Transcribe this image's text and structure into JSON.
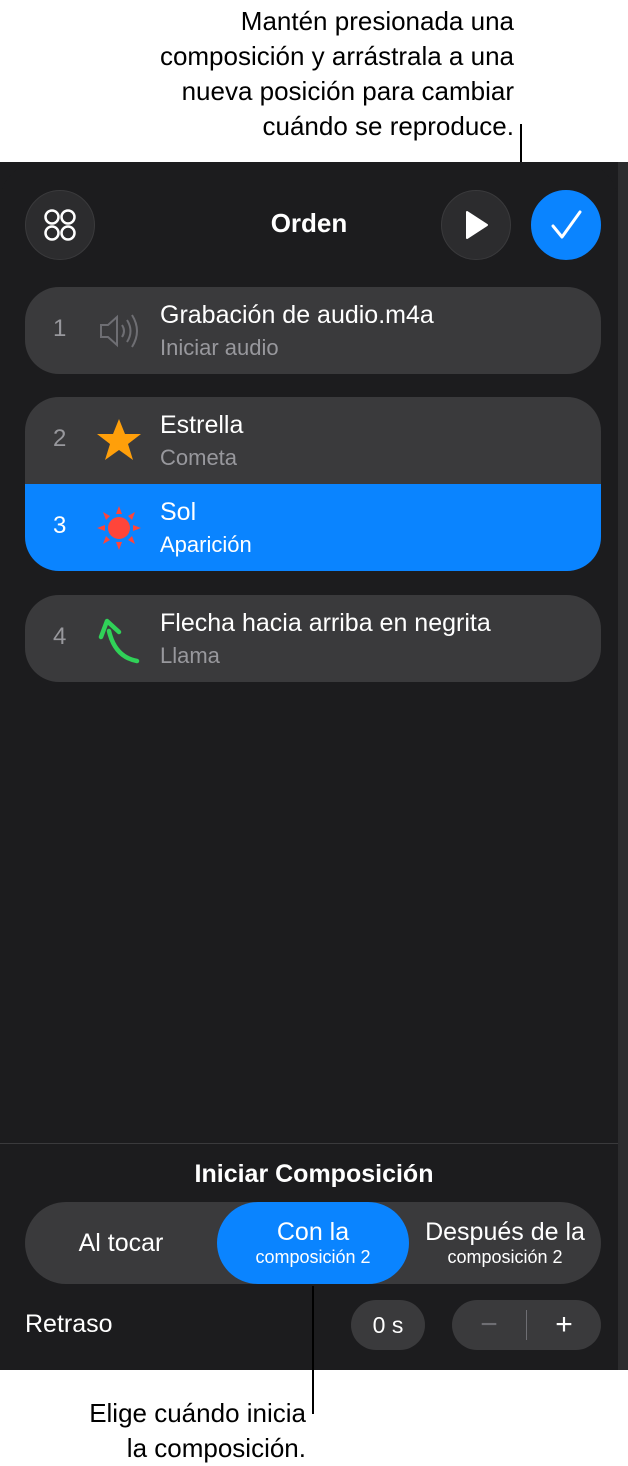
{
  "callouts": {
    "top": [
      "Mantén presionada una",
      "composición y arrástrala a una",
      "nueva posición para cambiar",
      "cuándo se reproduce."
    ],
    "bottom": [
      "Elige cuándo inicia",
      "la composición."
    ]
  },
  "header": {
    "title": "Orden",
    "grid_icon": "animations-grid-icon",
    "play_icon": "play-icon",
    "done_icon": "checkmark-icon"
  },
  "builds": [
    {
      "number": "1",
      "name": "Grabación de audio.m4a",
      "effect": "Iniciar audio",
      "icon": "speaker-icon"
    },
    {
      "number": "2",
      "name": "Estrella",
      "effect": "Cometa",
      "icon": "star-icon"
    },
    {
      "number": "3",
      "name": "Sol",
      "effect": "Aparición",
      "icon": "sun-icon"
    },
    {
      "number": "4",
      "name": "Flecha hacia arriba en negrita",
      "effect": "Llama",
      "icon": "arrow-icon"
    }
  ],
  "start": {
    "title": "Iniciar Composición",
    "options": [
      {
        "line1": "Al tocar",
        "line2": ""
      },
      {
        "line1": "Con la",
        "line2": "composición 2"
      },
      {
        "line1": "Después de la",
        "line2": "composición 2"
      }
    ],
    "selected_index": 1
  },
  "delay": {
    "label": "Retraso",
    "value": "0 s",
    "minus": "−",
    "plus": "+"
  },
  "colors": {
    "accent": "#0a84ff",
    "panel": "#1c1c1e",
    "row": "#3a3a3c",
    "star": "#ff9f0a",
    "sun": "#ff453a",
    "arrow": "#30d158"
  }
}
